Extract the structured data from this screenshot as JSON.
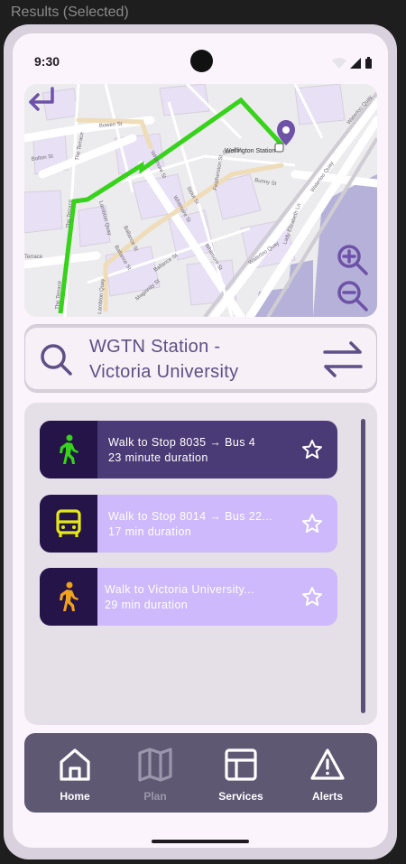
{
  "frame": {
    "title": "Results (Selected)"
  },
  "status_bar": {
    "time": "9:30"
  },
  "map": {
    "streets": [
      "Bowen St",
      "Bolton St",
      "The Terrace",
      "The Terrace",
      "The Terrace",
      "Lambton Quay",
      "Stout St",
      "Whitmore St",
      "Whitmore St",
      "Whitmore St",
      "Ballance St",
      "Ballance St",
      "Maginnity St",
      "Featherston St",
      "Bunny St",
      "Waterloo Quay",
      "Waterloo Quay",
      "Waterloo Quay",
      "Lady Elizabeth Ln",
      "Lambton Quay",
      "Terrace",
      "Stout St",
      "Ballance St"
    ],
    "landmark": "Wellington Station",
    "route_color": "#37d21b",
    "pin_color": "#6d52a8"
  },
  "search": {
    "line1": "WGTN Station -",
    "line2": "Victoria University"
  },
  "routes": [
    {
      "title": "Walk to Stop 8035 → Bus 4",
      "subtitle": "23 minute duration",
      "icon": "walk-icon",
      "icon_color": "#37d21b"
    },
    {
      "title": "Walk to Stop 8014 → Bus 22...",
      "subtitle": "17 min duration",
      "icon": "bus-icon",
      "icon_color": "#e4e81a"
    },
    {
      "title": "Walk to Victoria University...",
      "subtitle": "29 min duration",
      "icon": "walk-icon",
      "icon_color": "#f0a11e"
    }
  ],
  "nav": [
    {
      "label": "Home",
      "icon": "home-icon"
    },
    {
      "label": "Plan",
      "icon": "map-icon"
    },
    {
      "label": "Services",
      "icon": "grid-icon"
    },
    {
      "label": "Alerts",
      "icon": "alert-icon"
    }
  ],
  "colors": {
    "accent": "#5f4f86",
    "selected_route": "#4a3a76",
    "route": "#cdb9fb",
    "nav_bg": "#5f5873"
  }
}
